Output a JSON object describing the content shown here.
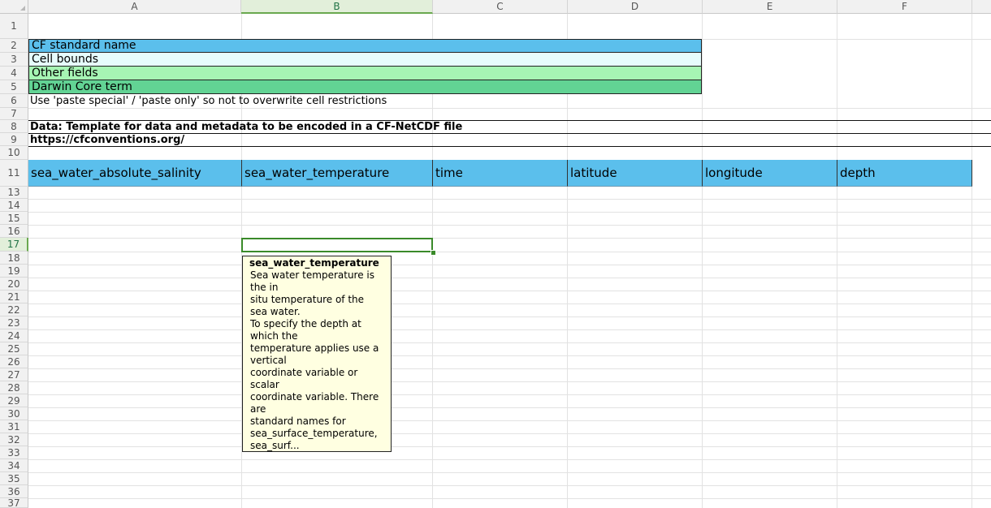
{
  "columns": [
    "A",
    "B",
    "C",
    "D",
    "E",
    "F"
  ],
  "selected_column": "B",
  "rows": [
    "1",
    "2",
    "3",
    "4",
    "5",
    "6",
    "7",
    "8",
    "9",
    "10",
    "11",
    "13",
    "14",
    "15",
    "16",
    "17",
    "18",
    "19",
    "20",
    "21",
    "22",
    "23",
    "24",
    "25",
    "26",
    "27",
    "28",
    "29",
    "30",
    "31",
    "32",
    "33",
    "34",
    "35",
    "36",
    "37"
  ],
  "selected_row": "17",
  "legend": {
    "cf_standard_name": "CF standard name",
    "cell_bounds": "Cell bounds",
    "other_fields": "Other fields",
    "darwin_core_term": "Darwin Core term",
    "colors": {
      "cf_standard_name": "#5bbfec",
      "cell_bounds": "#e6fcfc",
      "other_fields": "#a6f5b4",
      "darwin_core_term": "#62d394"
    }
  },
  "note": "Use 'paste special' / 'paste only' so not to overwrite cell restrictions",
  "data_title": "Data: Template for data and metadata to be encoded in a CF-NetCDF file",
  "link": "https://cfconventions.org/",
  "header_row": [
    "sea_water_absolute_salinity",
    "sea_water_temperature",
    "time",
    "latitude",
    "longitude",
    "depth"
  ],
  "tooltip": {
    "title": "sea_water_temperature",
    "lines": [
      "Sea water temperature is",
      "the in",
      "situ temperature of the",
      "sea water.",
      "To specify the depth at",
      "which the",
      "temperature applies use a",
      "vertical",
      "coordinate variable or",
      "scalar",
      "coordinate variable. There",
      "are",
      "standard names for",
      "sea_surface_temperature,",
      "sea_surf..."
    ]
  }
}
